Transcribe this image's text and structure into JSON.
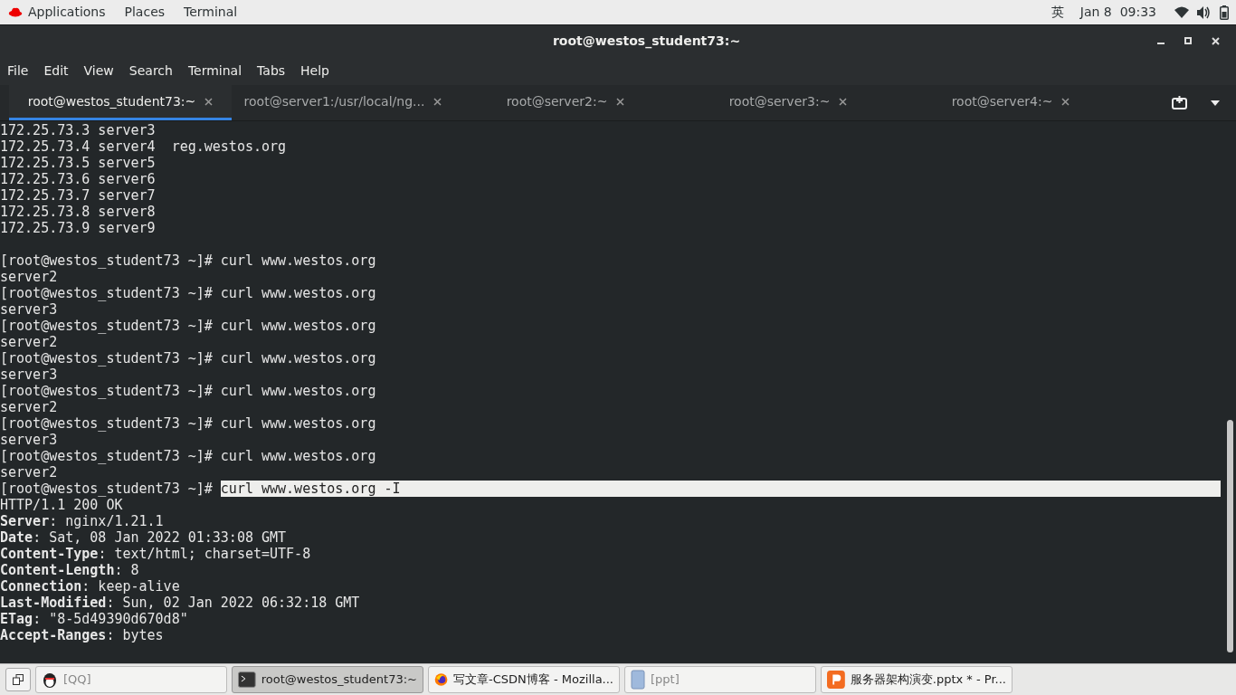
{
  "top_bar": {
    "menus": [
      "Applications",
      "Places",
      "Terminal"
    ],
    "input_method": "英",
    "clock": "Jan 8  09:33"
  },
  "window": {
    "title": "root@westos_student73:~"
  },
  "menu_bar": [
    "File",
    "Edit",
    "View",
    "Search",
    "Terminal",
    "Tabs",
    "Help"
  ],
  "tabs": [
    {
      "label": "root@westos_student73:~",
      "selected": true
    },
    {
      "label": "root@server1:/usr/local/ng...",
      "selected": false
    },
    {
      "label": "root@server2:~",
      "selected": false
    },
    {
      "label": "root@server3:~",
      "selected": false
    },
    {
      "label": "root@server4:~",
      "selected": false
    }
  ],
  "terminal_lines": [
    {
      "kind": "output",
      "text": "172.25.73.3 server3"
    },
    {
      "kind": "output",
      "text": "172.25.73.4 server4  reg.westos.org"
    },
    {
      "kind": "output",
      "text": "172.25.73.5 server5"
    },
    {
      "kind": "output",
      "text": "172.25.73.6 server6"
    },
    {
      "kind": "output",
      "text": "172.25.73.7 server7"
    },
    {
      "kind": "output",
      "text": "172.25.73.8 server8"
    },
    {
      "kind": "output",
      "text": "172.25.73.9 server9"
    },
    {
      "kind": "blank"
    },
    {
      "kind": "prompt",
      "prompt": "[root@westos_student73 ~]#",
      "command": "curl www.westos.org",
      "selected": false
    },
    {
      "kind": "output",
      "text": "server2"
    },
    {
      "kind": "prompt",
      "prompt": "[root@westos_student73 ~]#",
      "command": "curl www.westos.org",
      "selected": false
    },
    {
      "kind": "output",
      "text": "server3"
    },
    {
      "kind": "prompt",
      "prompt": "[root@westos_student73 ~]#",
      "command": "curl www.westos.org",
      "selected": false
    },
    {
      "kind": "output",
      "text": "server2"
    },
    {
      "kind": "prompt",
      "prompt": "[root@westos_student73 ~]#",
      "command": "curl www.westos.org",
      "selected": false
    },
    {
      "kind": "output",
      "text": "server3"
    },
    {
      "kind": "prompt",
      "prompt": "[root@westos_student73 ~]#",
      "command": "curl www.westos.org",
      "selected": false
    },
    {
      "kind": "output",
      "text": "server2"
    },
    {
      "kind": "prompt",
      "prompt": "[root@westos_student73 ~]#",
      "command": "curl www.westos.org",
      "selected": false
    },
    {
      "kind": "output",
      "text": "server3"
    },
    {
      "kind": "prompt",
      "prompt": "[root@westos_student73 ~]#",
      "command": "curl www.westos.org",
      "selected": false
    },
    {
      "kind": "output",
      "text": "server2"
    },
    {
      "kind": "prompt",
      "prompt": "[root@westos_student73 ~]#",
      "command": "curl www.westos.org -I",
      "selected": true
    },
    {
      "kind": "output",
      "text": "HTTP/1.1 200 OK"
    },
    {
      "kind": "output",
      "text": "**Server**: nginx/1.21.1"
    },
    {
      "kind": "output",
      "text": "**Date**: Sat, 08 Jan 2022 01:33:08 GMT"
    },
    {
      "kind": "output",
      "text": "**Content-Type**: text/html; charset=UTF-8"
    },
    {
      "kind": "output",
      "text": "**Content-Length**: 8"
    },
    {
      "kind": "output",
      "text": "**Connection**: keep-alive"
    },
    {
      "kind": "output",
      "text": "**Last-Modified**: Sun, 02 Jan 2022 06:32:18 GMT"
    },
    {
      "kind": "output",
      "text": "**ETag**: \"8-5d49390d670d8\""
    },
    {
      "kind": "output",
      "text": "**Accept-Ranges**: bytes"
    }
  ],
  "taskbar": [
    {
      "kind": "qq",
      "label": "[QQ]",
      "selected": false
    },
    {
      "kind": "terminal",
      "label": "root@westos_student73:~",
      "selected": true
    },
    {
      "kind": "browser",
      "label": "写文章-CSDN博客 - Mozilla...",
      "selected": false
    },
    {
      "kind": "file",
      "label": "[ppt]",
      "selected": false
    },
    {
      "kind": "slides",
      "label": "服务器架构演变.pptx * - Pr...",
      "selected": false
    }
  ]
}
